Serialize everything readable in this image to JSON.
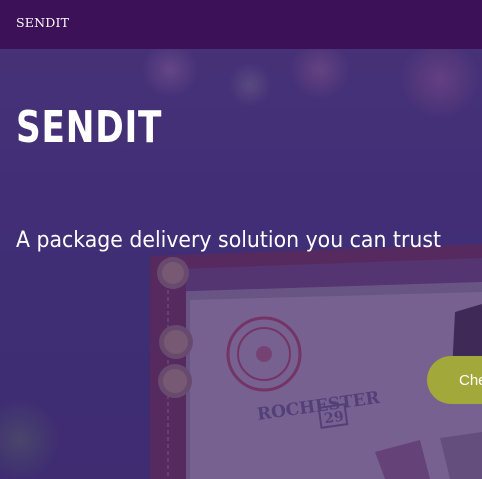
{
  "navbar": {
    "brand": "SENDIT"
  },
  "hero": {
    "title": "SENDIT",
    "tagline": "A package delivery solution you can trust",
    "cta_label": "Che",
    "background_image_stamp_text": "ROCHESTER",
    "background_image_stamp_number": "29"
  },
  "colors": {
    "navbar_bg": "#3d1157",
    "hero_overlay": "#4b3a7d",
    "cta_bg": "#a3a83a",
    "text": "#ffffff"
  }
}
